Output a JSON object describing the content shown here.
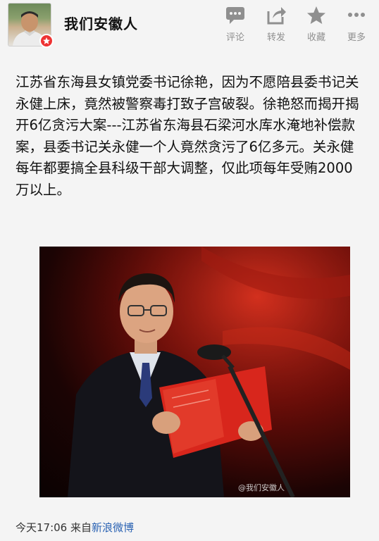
{
  "post": {
    "author": "我们安徽人",
    "content": "江苏省东海县女镇党委书记徐艳，因为不愿陪县委书记关永健上床，竟然被警察毒打致子宫破裂。徐艳怒而揭开揭开6亿贪污大案---江苏省东海县石梁河水库水淹地补偿款案，县委书记关永健一个人竟然贪污了6亿多元。关永健每年都要搞全县科级干部大调整，仅此项每年受贿2000万以上。",
    "image_watermark": "@我们安徽人\nhttp://weibo.com/u/2633891583",
    "timestamp": "今天17:06",
    "source_prefix": "来自",
    "source_link": "新浪微博"
  },
  "actions": [
    {
      "label": "评论",
      "icon": "comment-icon"
    },
    {
      "label": "转发",
      "icon": "forward-icon"
    },
    {
      "label": "收藏",
      "icon": "star-icon"
    },
    {
      "label": "更多",
      "icon": "more-icon"
    }
  ],
  "colors": {
    "background": "#f4f4f4",
    "action_gray": "#8f8f8f",
    "link_blue": "#2b63b3",
    "badge_red": "#e33"
  }
}
